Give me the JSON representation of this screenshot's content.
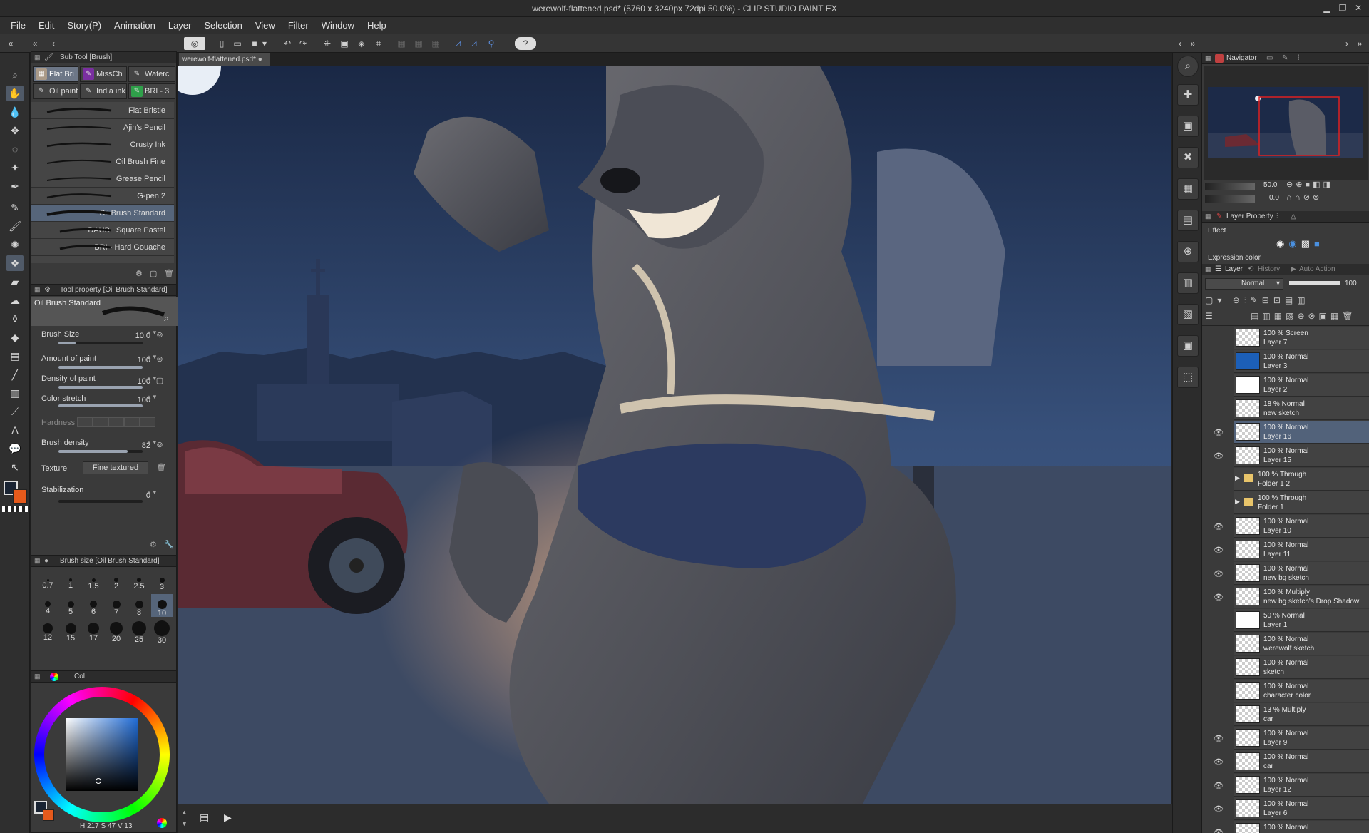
{
  "window": {
    "title": "werewolf-flattened.psd* (5760 x 3240px 72dpi 50.0%) - CLIP STUDIO PAINT EX"
  },
  "menu": [
    "File",
    "Edit",
    "Story(P)",
    "Animation",
    "Layer",
    "Selection",
    "View",
    "Filter",
    "Window",
    "Help"
  ],
  "document": {
    "tab": "werewolf-flattened.psd*"
  },
  "subtool": {
    "header": "Sub Tool [Brush]",
    "tabs": [
      "Flat Bri",
      "MissCh",
      "Waterc",
      "Oil paint",
      "India ink",
      "BRI - 3"
    ],
    "brushes": [
      "Flat Bristle",
      "Ajin's Pencil",
      "Crusty Ink",
      "Oil Brush Fine",
      "Grease Pencil",
      "G-pen 2",
      "Oil Brush Standard",
      "DAUB | Square Pastel",
      "BRI - Hard Gouache"
    ]
  },
  "toolprop": {
    "header": "Tool property [Oil Brush Standard]",
    "name": "Oil Brush Standard",
    "brush_size_label": "Brush Size",
    "brush_size": "10.0",
    "brush_size_pct": 0.2,
    "amount_label": "Amount of paint",
    "amount": "100",
    "amount_pct": 1,
    "density_label": "Density of paint",
    "density": "100",
    "density_pct": 1,
    "stretch_label": "Color stretch",
    "stretch": "100",
    "stretch_pct": 1,
    "hardness_label": "Hardness",
    "brush_density_label": "Brush density",
    "brush_density": "82",
    "brush_density_pct": 0.82,
    "texture_label": "Texture",
    "texture": "Fine textured",
    "stabilization_label": "Stabilization",
    "stabilization": "0",
    "stabilization_pct": 0
  },
  "brushsize": {
    "header": "Brush size [Oil Brush Standard]",
    "sizes": [
      "0.7",
      "1",
      "1.5",
      "2",
      "2.5",
      "3",
      "4",
      "5",
      "6",
      "7",
      "8",
      "10",
      "12",
      "15",
      "17",
      "20",
      "25",
      "30"
    ]
  },
  "color": {
    "tab": "Col",
    "h": "217",
    "s": "47",
    "v": "13",
    "main": "#1a2433",
    "sub": "#e55a1c"
  },
  "navigator": {
    "tab": "Navigator",
    "zoom": "50.0",
    "angle": "0.0"
  },
  "layerprop": {
    "tab": "Layer Property",
    "effect": "Effect",
    "expression": "Expression color"
  },
  "layers": {
    "tabs": [
      "Layer",
      "History",
      "Auto Action"
    ],
    "blend": "Normal",
    "opacity": "100",
    "items": [
      {
        "l1": "100 % Screen",
        "l2": "Layer 7",
        "thumb": "check",
        "eye": false
      },
      {
        "l1": "100 % Normal",
        "l2": "Layer 3",
        "thumb": "blue",
        "eye": false
      },
      {
        "l1": "100 % Normal",
        "l2": "Layer 2",
        "thumb": "white",
        "eye": false
      },
      {
        "l1": "18 % Normal",
        "l2": "new sketch",
        "thumb": "check",
        "eye": false
      },
      {
        "l1": "100 % Normal",
        "l2": "Layer 16",
        "thumb": "check",
        "eye": true,
        "sel": true
      },
      {
        "l1": "100 % Normal",
        "l2": "Layer 15",
        "thumb": "check",
        "eye": true
      },
      {
        "l1": "100 % Through",
        "l2": "Folder 1 2",
        "folder": true,
        "eye": false
      },
      {
        "l1": "100 % Through",
        "l2": "Folder 1",
        "folder": true,
        "eye": false
      },
      {
        "l1": "100 % Normal",
        "l2": "Layer 10",
        "thumb": "check",
        "eye": true
      },
      {
        "l1": "100 % Normal",
        "l2": "Layer 11",
        "thumb": "check",
        "eye": true
      },
      {
        "l1": "100 % Normal",
        "l2": "new bg sketch",
        "thumb": "check",
        "eye": true
      },
      {
        "l1": "100 % Multiply",
        "l2": "new bg sketch's Drop Shadow",
        "thumb": "check",
        "eye": true
      },
      {
        "l1": "50 % Normal",
        "l2": "Layer 1",
        "thumb": "white",
        "eye": false
      },
      {
        "l1": "100 % Normal",
        "l2": "werewolf sketch",
        "thumb": "check",
        "eye": false
      },
      {
        "l1": "100 % Normal",
        "l2": "sketch",
        "thumb": "check",
        "eye": false
      },
      {
        "l1": "100 % Normal",
        "l2": "character color",
        "thumb": "check",
        "eye": false
      },
      {
        "l1": "13 % Multiply",
        "l2": "car",
        "thumb": "check",
        "eye": false
      },
      {
        "l1": "100 % Normal",
        "l2": "Layer 9",
        "thumb": "check",
        "eye": true
      },
      {
        "l1": "100 % Normal",
        "l2": "car",
        "thumb": "check",
        "eye": true
      },
      {
        "l1": "100 % Normal",
        "l2": "Layer 12",
        "thumb": "check",
        "eye": true
      },
      {
        "l1": "100 % Normal",
        "l2": "Layer 6",
        "thumb": "check",
        "eye": true
      },
      {
        "l1": "100 % Normal",
        "l2": "",
        "thumb": "check",
        "eye": true
      }
    ]
  }
}
